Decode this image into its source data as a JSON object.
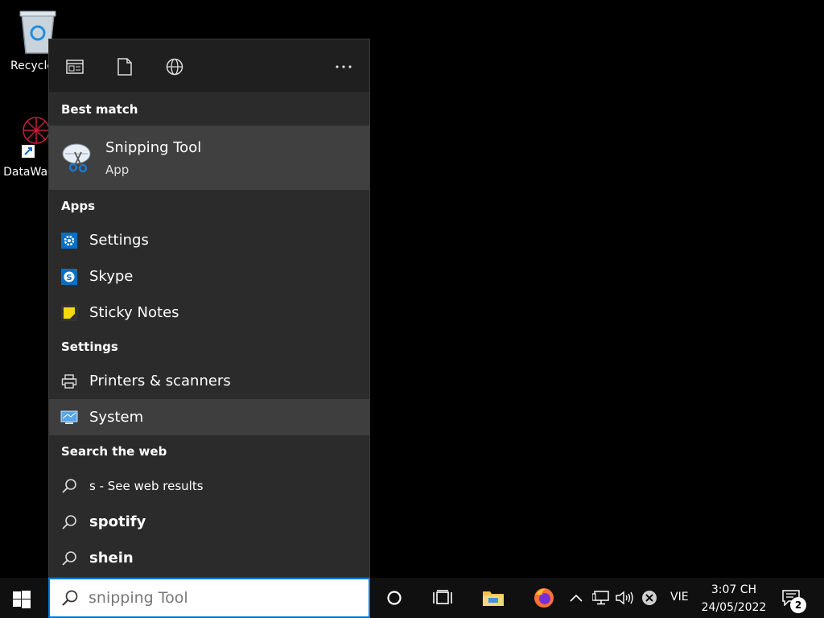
{
  "desktop": {
    "icons": [
      {
        "label": "Recycle"
      },
      {
        "label": "DataWag"
      }
    ]
  },
  "search_panel": {
    "sections": {
      "best_match": "Best match",
      "apps": "Apps",
      "settings": "Settings",
      "web": "Search the web"
    },
    "best_match": {
      "title": "Snipping Tool",
      "subtitle": "App"
    },
    "apps": [
      {
        "label": "Settings",
        "icon": "gear-icon"
      },
      {
        "label": "Skype",
        "icon": "skype-icon"
      },
      {
        "label": "Sticky Notes",
        "icon": "sticky-notes-icon"
      }
    ],
    "settings_items": [
      {
        "label": "Printers & scanners",
        "icon": "printer-icon"
      },
      {
        "label": "System",
        "icon": "monitor-icon"
      }
    ],
    "web": [
      {
        "label": "s - See web results"
      },
      {
        "label": "spotify"
      },
      {
        "label": "shein"
      }
    ]
  },
  "taskbar": {
    "search_value": "snipping Tool",
    "language": "VIE",
    "time": "3:07 CH",
    "date": "24/05/2022",
    "notification_count": "2"
  }
}
